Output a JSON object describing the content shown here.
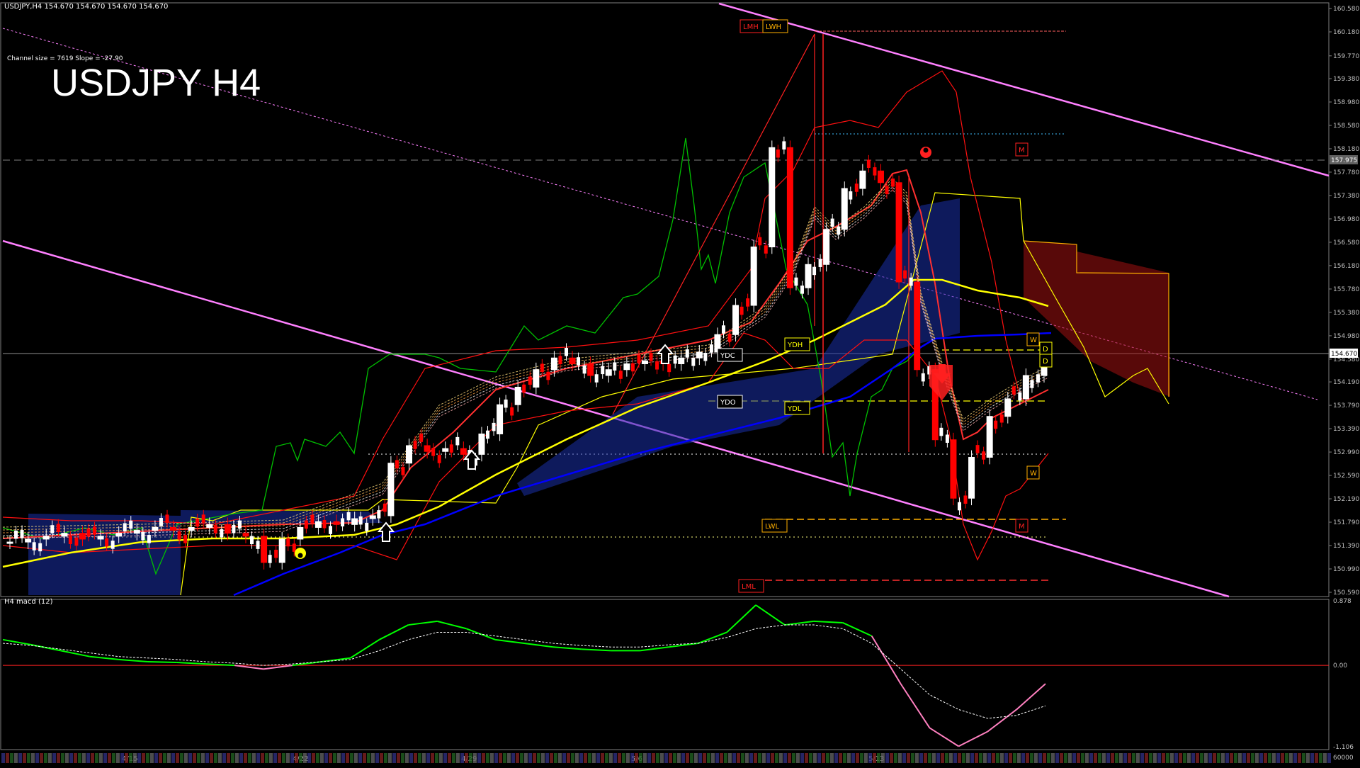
{
  "window": {
    "header": "USDJPY,H4  154.670 154.670 154.670 154.670",
    "channel_info": "Channel size = 7619 Slope = -27.90",
    "big_title": "USDJPY H4"
  },
  "colors": {
    "background": "#000000",
    "bull_candle": "#ffffff",
    "bear_candle": "#ff0000",
    "ema_slow": "#ffff00",
    "ema_slower": "#0000ff",
    "ichimoku_span": "#00aa00",
    "bands": "#ff0000",
    "channel": "#ff80ff",
    "kumo_fill": "#1a2fa8",
    "macd_line": "#00ff00",
    "macd_line_neg": "#ff80c0",
    "signal_line": "#ffffff"
  },
  "chart_data": [
    {
      "type": "line",
      "name": "main",
      "ylim": [
        150.59,
        160.58
      ],
      "y_ticks": [
        "160.580",
        "160.180",
        "159.770",
        "159.380",
        "158.980",
        "158.580",
        "158.180",
        "157.780",
        "157.380",
        "156.980",
        "156.580",
        "156.180",
        "155.780",
        "155.380",
        "154.980",
        "154.580",
        "154.190",
        "153.790",
        "153.390",
        "152.990",
        "152.590",
        "152.190",
        "151.790",
        "151.390",
        "150.990",
        "150.590"
      ],
      "x_labels": [
        "4/15",
        "4/22",
        "4/29",
        "5/6",
        "5/13"
      ],
      "current_price": "154.670",
      "marked_price": "157.975",
      "close_series": [
        151.45,
        151.5,
        151.55,
        151.6,
        151.5,
        151.55,
        151.6,
        151.65,
        151.7,
        151.65,
        151.7,
        151.75,
        151.6,
        151.55,
        151.1,
        151.5,
        151.7,
        151.8,
        151.75,
        151.85,
        151.9,
        152.8,
        153.1,
        153.0,
        153.05,
        152.95,
        153.3,
        153.8,
        154.1,
        154.4,
        154.6,
        154.5,
        154.3,
        154.4,
        154.5,
        154.55,
        154.5,
        154.6,
        154.7,
        155.0,
        155.5,
        156.5,
        158.2,
        155.8,
        156.2,
        156.8,
        157.5,
        157.8,
        157.6,
        155.9,
        154.4,
        153.2,
        152.2,
        152.9,
        153.6,
        153.9,
        154.3,
        154.67
      ],
      "levels": [
        {
          "label": "LMH",
          "value": 160.18
        },
        {
          "label": "LWH",
          "value": 160.18
        },
        {
          "label": "YDH",
          "value": 154.95
        },
        {
          "label": "YDC",
          "value": 154.63
        },
        {
          "label": "YDO",
          "value": 153.79
        },
        {
          "label": "YDL",
          "value": 153.75
        },
        {
          "label": "LWL",
          "value": 151.79
        },
        {
          "label": "LML",
          "value": 150.85
        },
        {
          "label": "W",
          "value": 154.82
        },
        {
          "label": "W",
          "value": 152.83
        },
        {
          "label": "D",
          "value": 154.75
        },
        {
          "label": "D",
          "value": 154.55
        },
        {
          "label": "M",
          "value": 157.98
        },
        {
          "label": "M",
          "value": 151.75
        }
      ]
    },
    {
      "type": "line",
      "name": "macd",
      "title": "H4 macd (12)",
      "ylim": [
        -1.106,
        0.878
      ],
      "y_ticks": [
        "0.878",
        "0.00",
        "-1.106"
      ],
      "bottom_tick": "60000",
      "macd_series": [
        0.35,
        0.28,
        0.2,
        0.12,
        0.08,
        0.05,
        0.04,
        0.02,
        0.0,
        -0.05,
        0.0,
        0.05,
        0.1,
        0.35,
        0.55,
        0.6,
        0.5,
        0.35,
        0.3,
        0.25,
        0.22,
        0.2,
        0.2,
        0.25,
        0.3,
        0.45,
        0.82,
        0.55,
        0.6,
        0.58,
        0.4,
        -0.25,
        -0.85,
        -1.1,
        -0.9,
        -0.6,
        -0.25
      ],
      "signal_series": [
        0.3,
        0.27,
        0.22,
        0.17,
        0.12,
        0.1,
        0.08,
        0.05,
        0.03,
        0.0,
        0.02,
        0.05,
        0.08,
        0.2,
        0.35,
        0.45,
        0.45,
        0.4,
        0.35,
        0.3,
        0.27,
        0.25,
        0.25,
        0.28,
        0.3,
        0.38,
        0.5,
        0.55,
        0.55,
        0.5,
        0.3,
        -0.05,
        -0.4,
        -0.6,
        -0.72,
        -0.68,
        -0.55
      ]
    }
  ]
}
